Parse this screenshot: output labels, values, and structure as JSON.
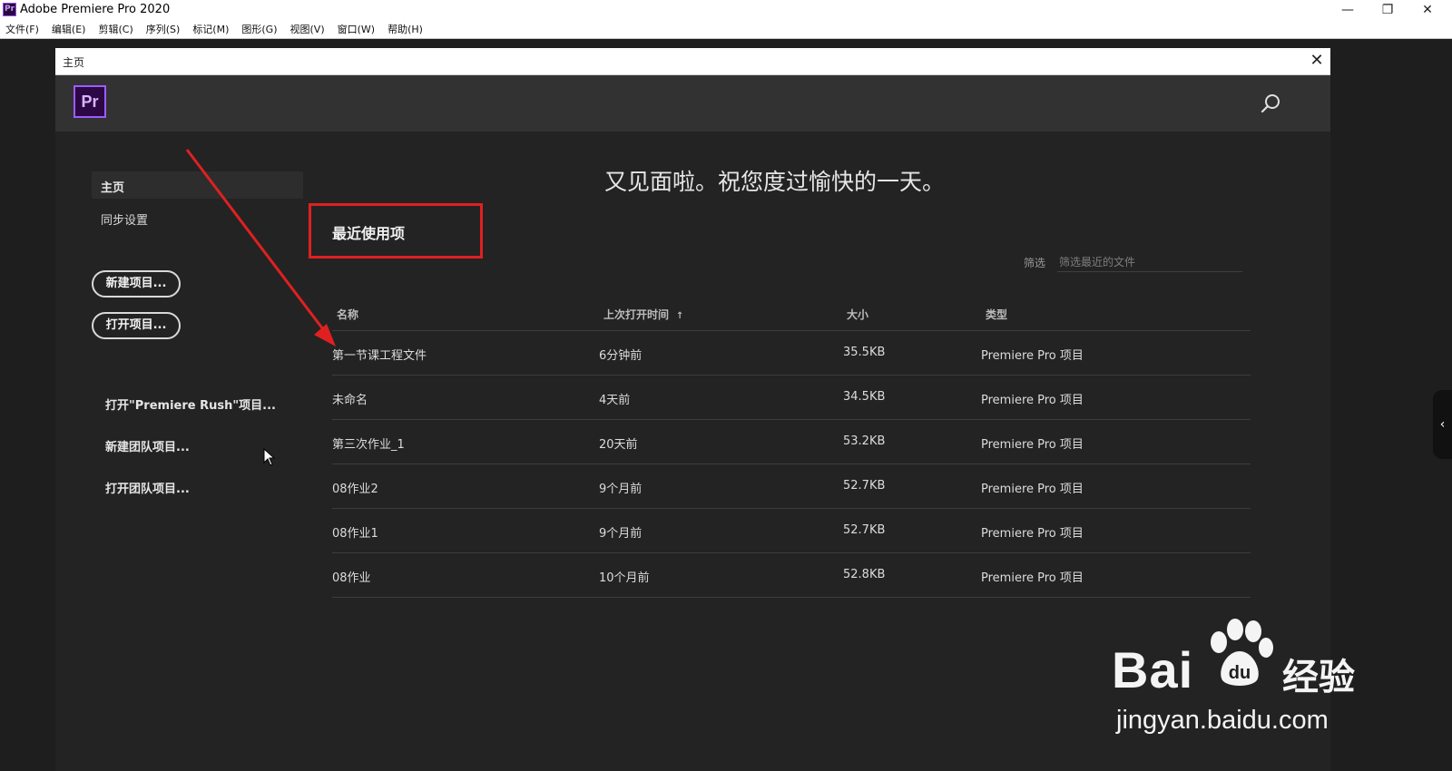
{
  "app": {
    "title": "Adobe Premiere Pro 2020",
    "logo_text": "Pr"
  },
  "window_controls": {
    "minimize": "—",
    "restore": "❐",
    "close": "✕"
  },
  "menu": [
    "文件(F)",
    "编辑(E)",
    "剪辑(C)",
    "序列(S)",
    "标记(M)",
    "图形(G)",
    "视图(V)",
    "窗口(W)",
    "帮助(H)"
  ],
  "dialog": {
    "title": "主页",
    "close": "✕",
    "logo_text": "Pr",
    "search_icon": "search-icon"
  },
  "sidebar": {
    "home": "主页",
    "sync": "同步设置",
    "new_project": "新建项目...",
    "open_project": "打开项目...",
    "open_rush": "打开\"Premiere Rush\"项目...",
    "new_team_project": "新建团队项目...",
    "open_team_project": "打开团队项目..."
  },
  "main": {
    "greeting": "又见面啦。祝您度过愉快的一天。",
    "recent_title": "最近使用项",
    "filter_label": "筛选",
    "filter_placeholder": "筛选最近的文件"
  },
  "table": {
    "headers": {
      "name": "名称",
      "time": "上次打开时间",
      "size": "大小",
      "type": "类型"
    },
    "sort_indicator": "↑",
    "rows": [
      {
        "name": "第一节课工程文件",
        "time": "6分钟前",
        "size": "35.5KB",
        "type": "Premiere Pro 项目"
      },
      {
        "name": "未命名",
        "time": "4天前",
        "size": "34.5KB",
        "type": "Premiere Pro 项目"
      },
      {
        "name": "第三次作业_1",
        "time": "20天前",
        "size": "53.2KB",
        "type": "Premiere Pro 项目"
      },
      {
        "name": "08作业2",
        "time": "9个月前",
        "size": "52.7KB",
        "type": "Premiere Pro 项目"
      },
      {
        "name": "08作业1",
        "time": "9个月前",
        "size": "52.7KB",
        "type": "Premiere Pro 项目"
      },
      {
        "name": "08作业",
        "time": "10个月前",
        "size": "52.8KB",
        "type": "Premiere Pro 项目"
      }
    ]
  },
  "side_tab": "‹",
  "watermark": {
    "brand": "Bai",
    "brand_cn": "经验",
    "url": "jingyan.baidu.com"
  },
  "colors": {
    "background": "#1e1e1e",
    "header": "#323232",
    "annotation": "#e02020",
    "logo_border": "#9c5cff"
  }
}
